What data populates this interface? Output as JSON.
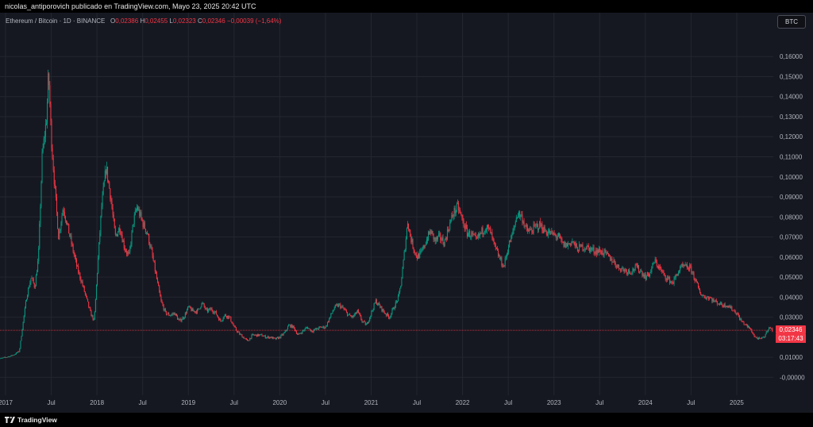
{
  "header": {
    "publisher_line": "nicolas_antiporovich publicado en TradingView.com, Mayo 23, 2025 20:42 UTC"
  },
  "legend": {
    "symbol": "Ethereum / Bitcoin · 1D · BINANCE",
    "open_label": "O",
    "open": "0,02386",
    "high_label": "H",
    "high": "0,02455",
    "low_label": "L",
    "low": "0,02323",
    "close_label": "C",
    "close": "0,02346",
    "change": "−0,00039 (−1,64%)"
  },
  "controls": {
    "currency_button": "BTC"
  },
  "price_tag": {
    "price": "0,02346",
    "countdown": "03:17:43"
  },
  "footer": {
    "brand": "TradingView"
  },
  "colors": {
    "up": "#089981",
    "down": "#f23645",
    "background": "#161821",
    "grid": "#23262f"
  },
  "chart_data": {
    "type": "candlestick",
    "y_ticks": [
      "0,16000",
      "0,15000",
      "0,14000",
      "0,13000",
      "0,12000",
      "0,11000",
      "0,10000",
      "0,09000",
      "0,08000",
      "0,07000",
      "0,06000",
      "0,05000",
      "0,04000",
      "0,03000",
      "0,01000",
      "-0,00000"
    ],
    "y_tick_values": [
      0.16,
      0.15,
      0.14,
      0.13,
      0.12,
      0.11,
      0.1,
      0.09,
      0.08,
      0.07,
      0.06,
      0.05,
      0.04,
      0.03,
      0.01,
      0.0
    ],
    "ylim": [
      -0.0042,
      0.1676
    ],
    "x_ticks": [
      "2017",
      "Jul",
      "2018",
      "Jul",
      "2019",
      "Jul",
      "2020",
      "Jul",
      "2021",
      "Jul",
      "2022",
      "Jul",
      "2023",
      "Jul",
      "2024",
      "Jul",
      "2025"
    ],
    "x_tick_values": [
      2017.0,
      2017.5,
      2018.0,
      2018.5,
      2019.0,
      2019.5,
      2020.0,
      2020.5,
      2021.0,
      2021.5,
      2022.0,
      2022.5,
      2023.0,
      2023.5,
      2024.0,
      2024.5,
      2025.0
    ],
    "xlim": [
      2017.0,
      2025.4
    ],
    "current_price": 0.02346,
    "price_path": [
      [
        2016.9,
        0.009
      ],
      [
        2016.96,
        0.0095
      ],
      [
        2017.0,
        0.01
      ],
      [
        2017.05,
        0.0105
      ],
      [
        2017.1,
        0.0115
      ],
      [
        2017.15,
        0.013
      ],
      [
        2017.2,
        0.03
      ],
      [
        2017.23,
        0.04
      ],
      [
        2017.28,
        0.05
      ],
      [
        2017.32,
        0.045
      ],
      [
        2017.36,
        0.06
      ],
      [
        2017.4,
        0.11
      ],
      [
        2017.45,
        0.13
      ],
      [
        2017.47,
        0.152
      ],
      [
        2017.5,
        0.12
      ],
      [
        2017.53,
        0.1
      ],
      [
        2017.58,
        0.07
      ],
      [
        2017.63,
        0.085
      ],
      [
        2017.68,
        0.075
      ],
      [
        2017.73,
        0.065
      ],
      [
        2017.78,
        0.055
      ],
      [
        2017.83,
        0.048
      ],
      [
        2017.88,
        0.04
      ],
      [
        2017.93,
        0.032
      ],
      [
        2017.97,
        0.028
      ],
      [
        2018.0,
        0.05
      ],
      [
        2018.05,
        0.085
      ],
      [
        2018.1,
        0.105
      ],
      [
        2018.15,
        0.09
      ],
      [
        2018.2,
        0.07
      ],
      [
        2018.25,
        0.075
      ],
      [
        2018.3,
        0.065
      ],
      [
        2018.35,
        0.06
      ],
      [
        2018.4,
        0.078
      ],
      [
        2018.44,
        0.085
      ],
      [
        2018.5,
        0.077
      ],
      [
        2018.55,
        0.072
      ],
      [
        2018.6,
        0.062
      ],
      [
        2018.65,
        0.05
      ],
      [
        2018.7,
        0.038
      ],
      [
        2018.75,
        0.032
      ],
      [
        2018.8,
        0.031
      ],
      [
        2018.85,
        0.032
      ],
      [
        2018.9,
        0.028
      ],
      [
        2018.95,
        0.03
      ],
      [
        2019.0,
        0.035
      ],
      [
        2019.05,
        0.033
      ],
      [
        2019.1,
        0.033
      ],
      [
        2019.15,
        0.037
      ],
      [
        2019.2,
        0.033
      ],
      [
        2019.25,
        0.034
      ],
      [
        2019.3,
        0.032
      ],
      [
        2019.35,
        0.028
      ],
      [
        2019.4,
        0.031
      ],
      [
        2019.45,
        0.03
      ],
      [
        2019.5,
        0.025
      ],
      [
        2019.55,
        0.022
      ],
      [
        2019.6,
        0.02
      ],
      [
        2019.65,
        0.018
      ],
      [
        2019.7,
        0.021
      ],
      [
        2019.75,
        0.021
      ],
      [
        2019.8,
        0.021
      ],
      [
        2019.85,
        0.02
      ],
      [
        2019.9,
        0.02
      ],
      [
        2019.95,
        0.019
      ],
      [
        2020.0,
        0.02
      ],
      [
        2020.05,
        0.022
      ],
      [
        2020.1,
        0.026
      ],
      [
        2020.15,
        0.025
      ],
      [
        2020.2,
        0.021
      ],
      [
        2020.25,
        0.023
      ],
      [
        2020.3,
        0.025
      ],
      [
        2020.35,
        0.023
      ],
      [
        2020.4,
        0.024
      ],
      [
        2020.45,
        0.025
      ],
      [
        2020.5,
        0.025
      ],
      [
        2020.55,
        0.03
      ],
      [
        2020.6,
        0.035
      ],
      [
        2020.65,
        0.036
      ],
      [
        2020.7,
        0.034
      ],
      [
        2020.75,
        0.031
      ],
      [
        2020.8,
        0.03
      ],
      [
        2020.85,
        0.033
      ],
      [
        2020.9,
        0.028
      ],
      [
        2020.95,
        0.026
      ],
      [
        2021.0,
        0.032
      ],
      [
        2021.05,
        0.038
      ],
      [
        2021.1,
        0.035
      ],
      [
        2021.15,
        0.032
      ],
      [
        2021.2,
        0.03
      ],
      [
        2021.25,
        0.035
      ],
      [
        2021.3,
        0.04
      ],
      [
        2021.33,
        0.048
      ],
      [
        2021.37,
        0.065
      ],
      [
        2021.4,
        0.078
      ],
      [
        2021.43,
        0.07
      ],
      [
        2021.46,
        0.065
      ],
      [
        2021.5,
        0.06
      ],
      [
        2021.55,
        0.062
      ],
      [
        2021.6,
        0.068
      ],
      [
        2021.65,
        0.073
      ],
      [
        2021.7,
        0.068
      ],
      [
        2021.75,
        0.07
      ],
      [
        2021.8,
        0.067
      ],
      [
        2021.85,
        0.075
      ],
      [
        2021.9,
        0.082
      ],
      [
        2021.95,
        0.085
      ],
      [
        2022.0,
        0.078
      ],
      [
        2022.05,
        0.072
      ],
      [
        2022.1,
        0.071
      ],
      [
        2022.15,
        0.068
      ],
      [
        2022.2,
        0.072
      ],
      [
        2022.25,
        0.075
      ],
      [
        2022.3,
        0.073
      ],
      [
        2022.35,
        0.065
      ],
      [
        2022.4,
        0.06
      ],
      [
        2022.45,
        0.055
      ],
      [
        2022.5,
        0.065
      ],
      [
        2022.55,
        0.072
      ],
      [
        2022.6,
        0.082
      ],
      [
        2022.65,
        0.08
      ],
      [
        2022.7,
        0.073
      ],
      [
        2022.75,
        0.073
      ],
      [
        2022.8,
        0.075
      ],
      [
        2022.85,
        0.076
      ],
      [
        2022.9,
        0.073
      ],
      [
        2022.95,
        0.072
      ],
      [
        2023.0,
        0.071
      ],
      [
        2023.05,
        0.07
      ],
      [
        2023.1,
        0.066
      ],
      [
        2023.15,
        0.066
      ],
      [
        2023.2,
        0.068
      ],
      [
        2023.25,
        0.064
      ],
      [
        2023.3,
        0.065
      ],
      [
        2023.35,
        0.065
      ],
      [
        2023.4,
        0.064
      ],
      [
        2023.45,
        0.063
      ],
      [
        2023.5,
        0.063
      ],
      [
        2023.55,
        0.062
      ],
      [
        2023.6,
        0.06
      ],
      [
        2023.65,
        0.058
      ],
      [
        2023.7,
        0.055
      ],
      [
        2023.75,
        0.054
      ],
      [
        2023.8,
        0.053
      ],
      [
        2023.85,
        0.053
      ],
      [
        2023.9,
        0.055
      ],
      [
        2023.95,
        0.053
      ],
      [
        2024.0,
        0.05
      ],
      [
        2024.05,
        0.052
      ],
      [
        2024.1,
        0.058
      ],
      [
        2024.15,
        0.055
      ],
      [
        2024.2,
        0.051
      ],
      [
        2024.25,
        0.049
      ],
      [
        2024.3,
        0.047
      ],
      [
        2024.35,
        0.052
      ],
      [
        2024.4,
        0.055
      ],
      [
        2024.45,
        0.055
      ],
      [
        2024.5,
        0.054
      ],
      [
        2024.55,
        0.048
      ],
      [
        2024.6,
        0.042
      ],
      [
        2024.65,
        0.04
      ],
      [
        2024.7,
        0.04
      ],
      [
        2024.75,
        0.038
      ],
      [
        2024.8,
        0.037
      ],
      [
        2024.85,
        0.036
      ],
      [
        2024.9,
        0.036
      ],
      [
        2024.95,
        0.034
      ],
      [
        2025.0,
        0.032
      ],
      [
        2025.05,
        0.028
      ],
      [
        2025.1,
        0.026
      ],
      [
        2025.15,
        0.024
      ],
      [
        2025.2,
        0.02
      ],
      [
        2025.25,
        0.019
      ],
      [
        2025.3,
        0.02
      ],
      [
        2025.35,
        0.025
      ],
      [
        2025.39,
        0.02346
      ]
    ]
  }
}
